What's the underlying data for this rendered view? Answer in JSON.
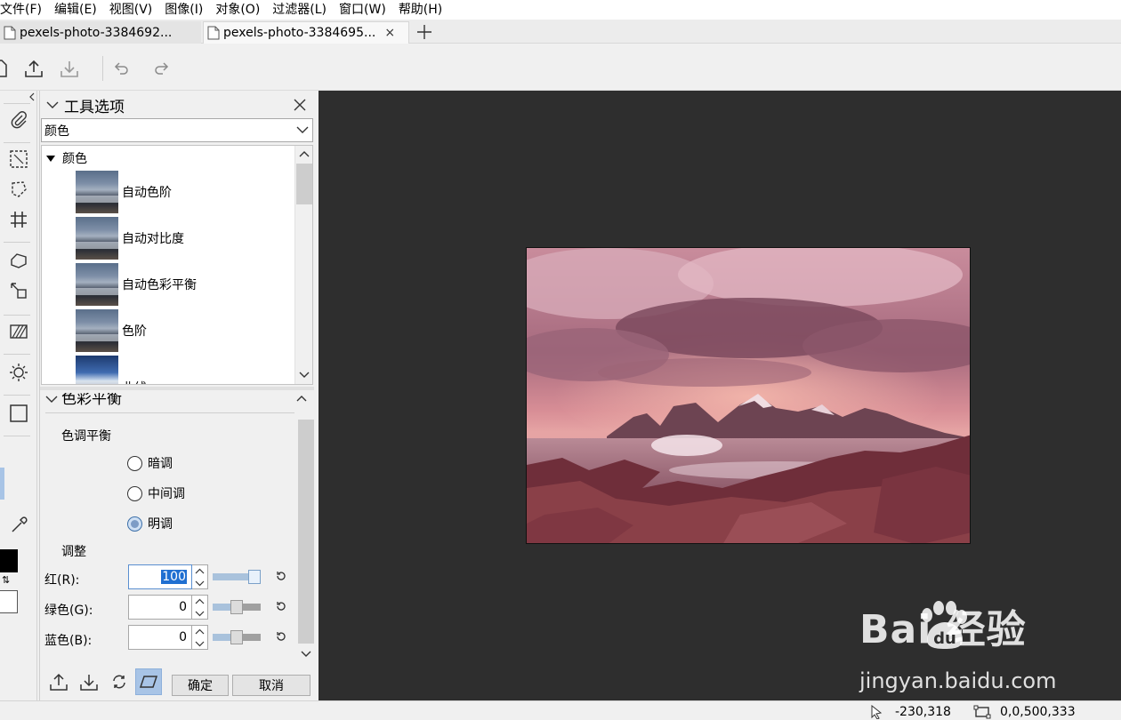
{
  "menu": [
    "文件(F)",
    "编辑(E)",
    "视图(V)",
    "图像(I)",
    "对象(O)",
    "过滤器(L)",
    "窗口(W)",
    "帮助(H)"
  ],
  "tabs": [
    {
      "label": "pexels-photo-3384692...",
      "active": false
    },
    {
      "label": "pexels-photo-3384695...",
      "active": true,
      "close": "×"
    }
  ],
  "tool_options": {
    "title": "工具选项",
    "category": "颜色",
    "group": "颜色",
    "items": [
      "自动色阶",
      "自动对比度",
      "自动色彩平衡",
      "色阶",
      "曲线"
    ]
  },
  "color_balance": {
    "title": "色彩平衡",
    "tone_label": "色调平衡",
    "tones": [
      {
        "label": "暗调",
        "checked": false
      },
      {
        "label": "中间调",
        "checked": false
      },
      {
        "label": "明调",
        "checked": true
      }
    ],
    "adjust_label": "调整",
    "channels": [
      {
        "label": "红(R):",
        "value": "100",
        "level": 1.0
      },
      {
        "label": "绿色(G):",
        "value": "0",
        "level": 0.5
      },
      {
        "label": "蓝色(B):",
        "value": "0",
        "level": 0.5
      }
    ],
    "ok_label": "确定",
    "cancel_label": "取消"
  },
  "status": {
    "cursor": "-230,318",
    "selection": "0,0,500,333"
  },
  "watermark": {
    "brand": "Bai  经验",
    "url": "jingyan.baidu.com"
  },
  "colors": {
    "canvas_bg": "#2e2e2e",
    "accent": "#1f6fd1",
    "active_tool": "#a8c4e6"
  }
}
